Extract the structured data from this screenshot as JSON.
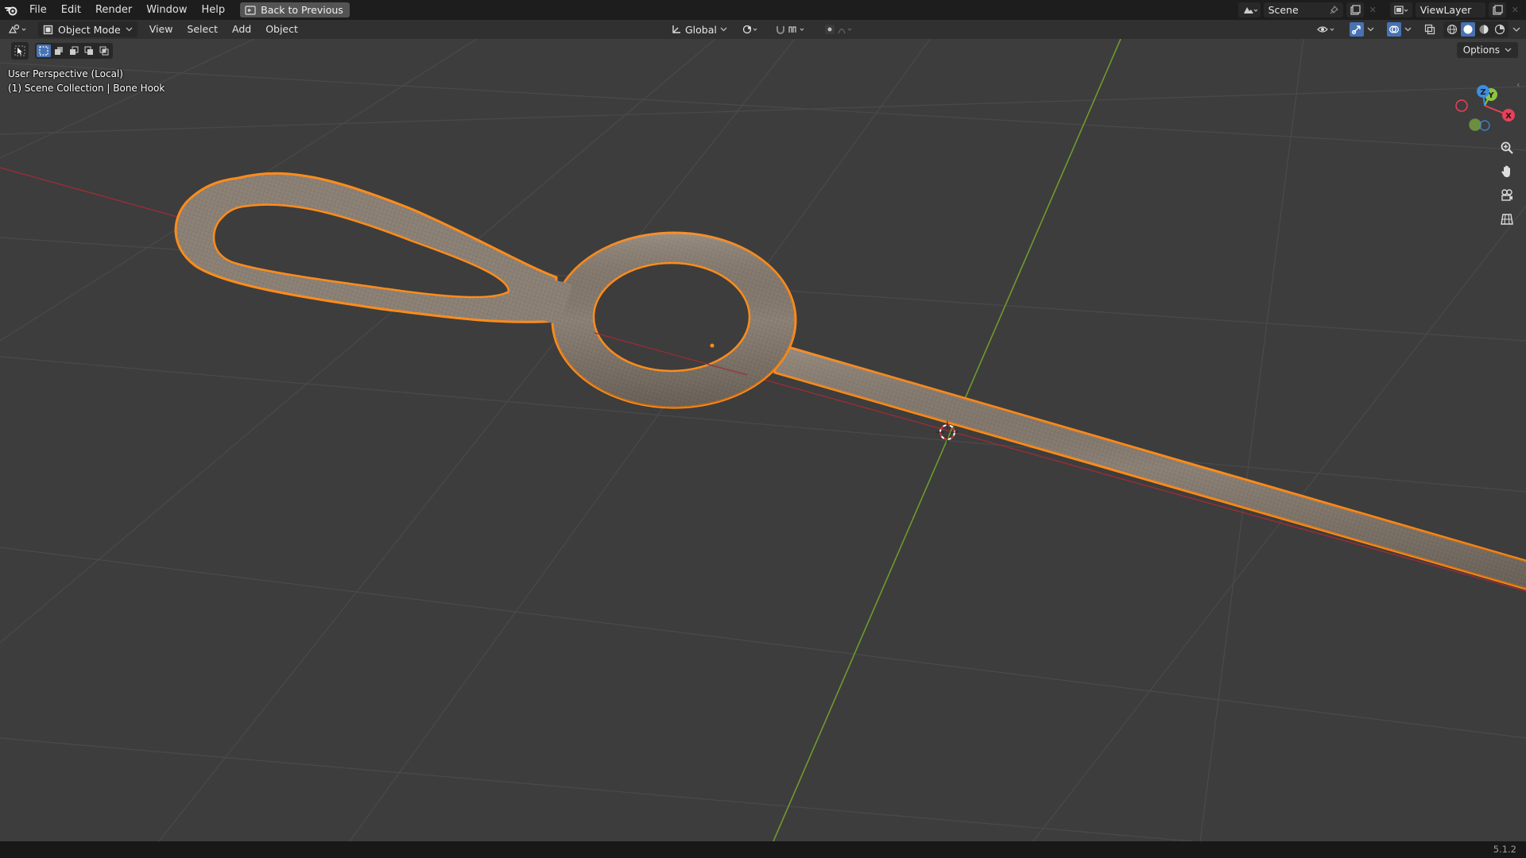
{
  "menubar": {
    "items": [
      "File",
      "Edit",
      "Render",
      "Window",
      "Help"
    ],
    "back_button": "Back to Previous",
    "scene_name": "Scene",
    "view_layer": "ViewLayer"
  },
  "viewport_header": {
    "mode": "Object Mode",
    "menus": [
      "View",
      "Select",
      "Add",
      "Object"
    ],
    "orientation": "Global",
    "options_label": "Options"
  },
  "overlay": {
    "view_name": "User Perspective (Local)",
    "collection_info": "(1) Scene Collection | Bone Hook"
  },
  "gizmo": {
    "x_label": "X",
    "y_label": "Y",
    "z_label": "Z",
    "x_color": "#e8415a",
    "y_color": "#8cc63f",
    "z_color": "#3d8ee0"
  },
  "colors": {
    "selection_outline": "#ff8c1a",
    "mesh_fill": "#8e8378",
    "x_axis": "#b8323e",
    "y_axis": "#7fa12d",
    "accent": "#4772b3"
  },
  "statusbar": {
    "version": "5.1.2"
  }
}
